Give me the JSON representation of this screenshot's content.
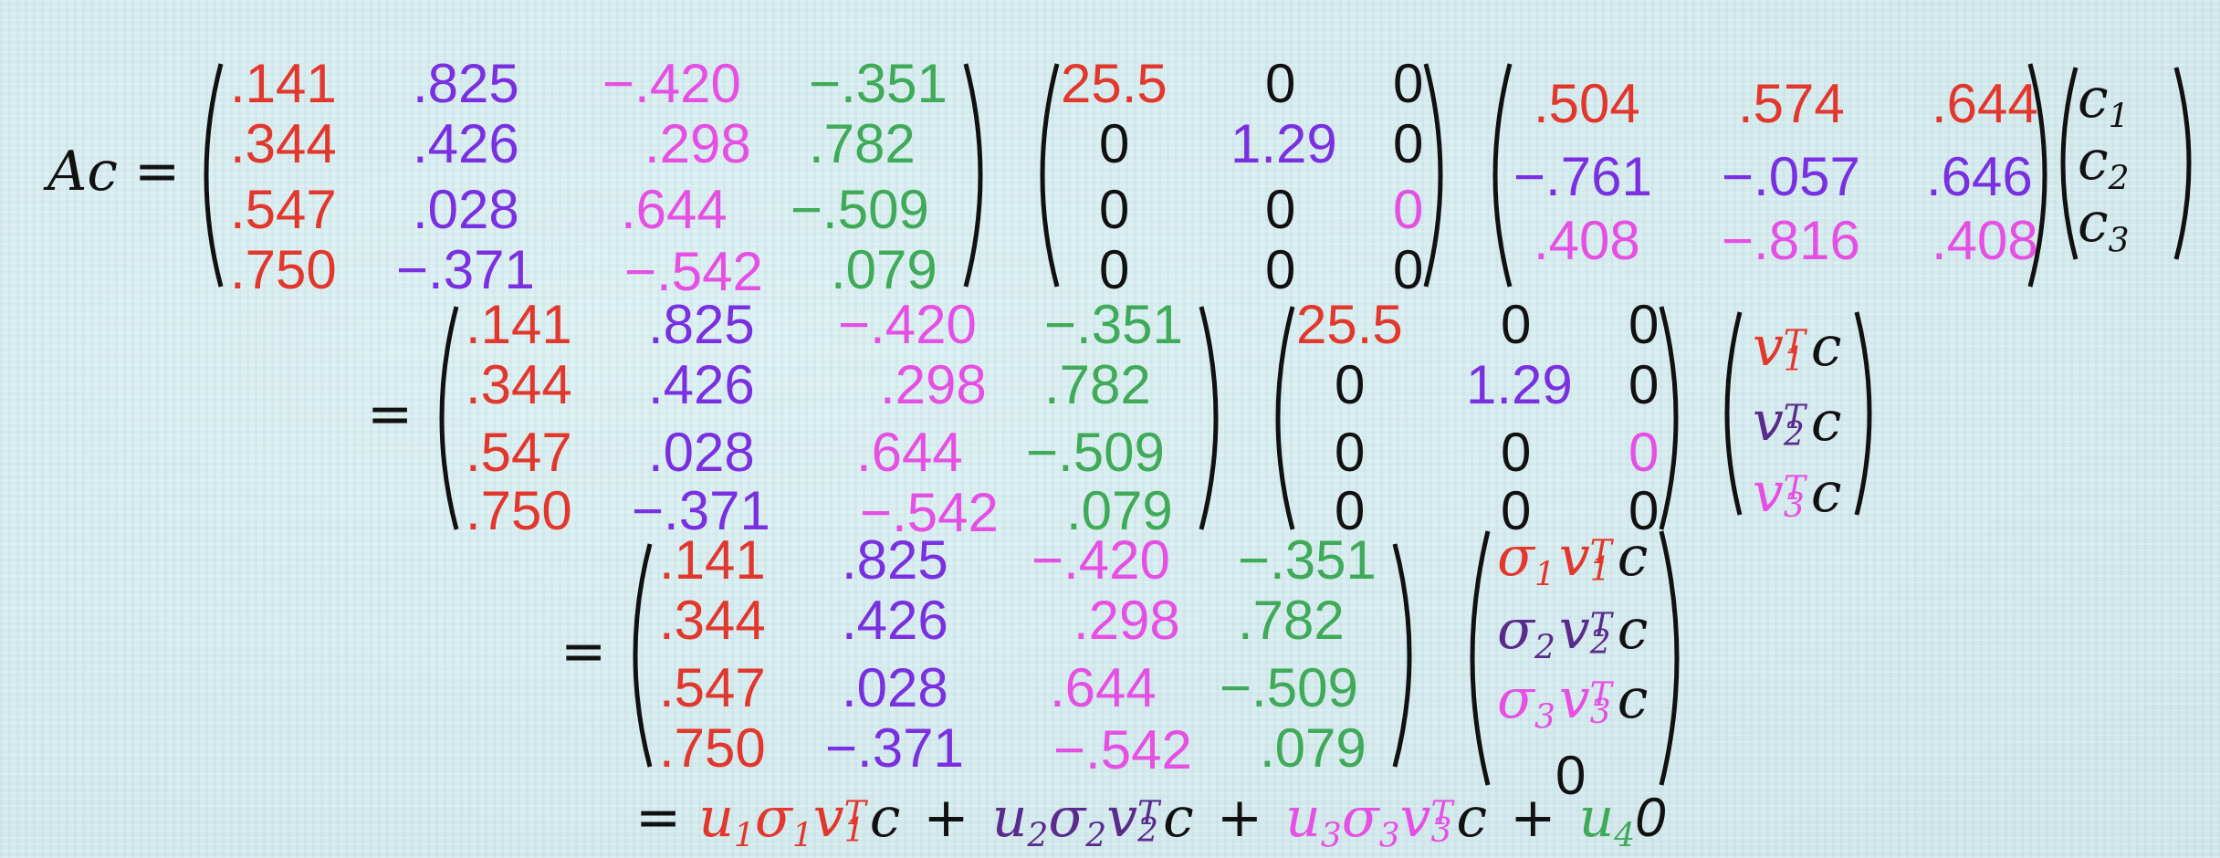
{
  "colors": {
    "red": "#e2372c",
    "purple": "#7a2fe0",
    "magenta": "#e64fe3",
    "green": "#3faa58",
    "black": "#111111",
    "indigo": "#5a2b8c"
  },
  "matrix_U": [
    [
      ".141",
      ".825",
      "−.420",
      "−.351"
    ],
    [
      ".344",
      ".426",
      ".298",
      ".782"
    ],
    [
      ".547",
      ".028",
      ".644",
      "−.509"
    ],
    [
      ".750",
      "−.371",
      "−.542",
      ".079"
    ]
  ],
  "matrix_Sigma": [
    [
      "25.5",
      "0",
      "0"
    ],
    [
      "0",
      "1.29",
      "0"
    ],
    [
      "0",
      "0",
      "0"
    ],
    [
      "0",
      "0",
      "0"
    ]
  ],
  "matrix_VT": [
    [
      ".504",
      ".574",
      ".644"
    ],
    [
      "−.761",
      "−.057",
      ".646"
    ],
    [
      ".408",
      "−.816",
      ".408"
    ]
  ],
  "lhs": {
    "A": "A",
    "c": "c",
    "eq": "="
  },
  "vec_c": {
    "c": "c",
    "subs": [
      "1",
      "2",
      "3"
    ]
  },
  "vec_vTc": {
    "v": "v",
    "T": "T",
    "c": "c",
    "subs": [
      "1",
      "2",
      "3"
    ]
  },
  "vec_svTc": {
    "sigma": "σ",
    "v": "v",
    "T": "T",
    "c": "c",
    "subs": [
      "1",
      "2",
      "3"
    ],
    "zero": "0"
  },
  "final": {
    "eq": "=",
    "u": "u",
    "sigma": "σ",
    "v": "v",
    "T": "T",
    "c": "c",
    "plus": "+",
    "subs": [
      "1",
      "2",
      "3",
      "4"
    ],
    "zero": "0"
  }
}
